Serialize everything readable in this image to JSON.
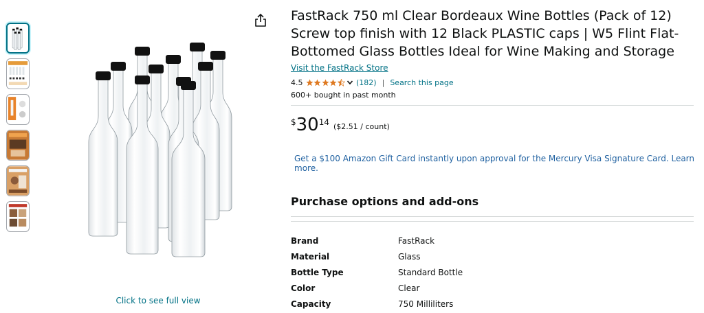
{
  "product": {
    "title": "FastRack 750 ml Clear Bordeaux Wine Bottles (Pack of 12) Screw top finish with 12 Black PLASTIC caps | W5 Flint Flat-Bottomed Glass Bottles Ideal for Wine Making and Storage",
    "store_link": "Visit the FastRack Store",
    "rating": "4.5",
    "rating_count": "(182)",
    "search_page": "Search this page",
    "separator": "|",
    "bought": "600+ bought in past month"
  },
  "price": {
    "symbol": "$",
    "whole": "30",
    "fraction": "14",
    "unit": "($2.51 / count)"
  },
  "promo": "Get a $100 Amazon Gift Card instantly upon approval for the Mercury Visa Signature Card. Learn more.",
  "purchase_options_title": "Purchase options and add-ons",
  "specs": [
    {
      "label": "Brand",
      "value": "FastRack"
    },
    {
      "label": "Material",
      "value": "Glass"
    },
    {
      "label": "Bottle Type",
      "value": "Standard Bottle"
    },
    {
      "label": "Color",
      "value": "Clear"
    },
    {
      "label": "Capacity",
      "value": "750 Milliliters"
    }
  ],
  "image": {
    "full_view": "Click to see full view"
  },
  "colors": {
    "link": "#007185",
    "promo": "#2162a1",
    "star": "#de7921",
    "text": "#0f1111"
  },
  "icons": [
    "share-icon",
    "star-icon",
    "chevron-down-icon"
  ]
}
